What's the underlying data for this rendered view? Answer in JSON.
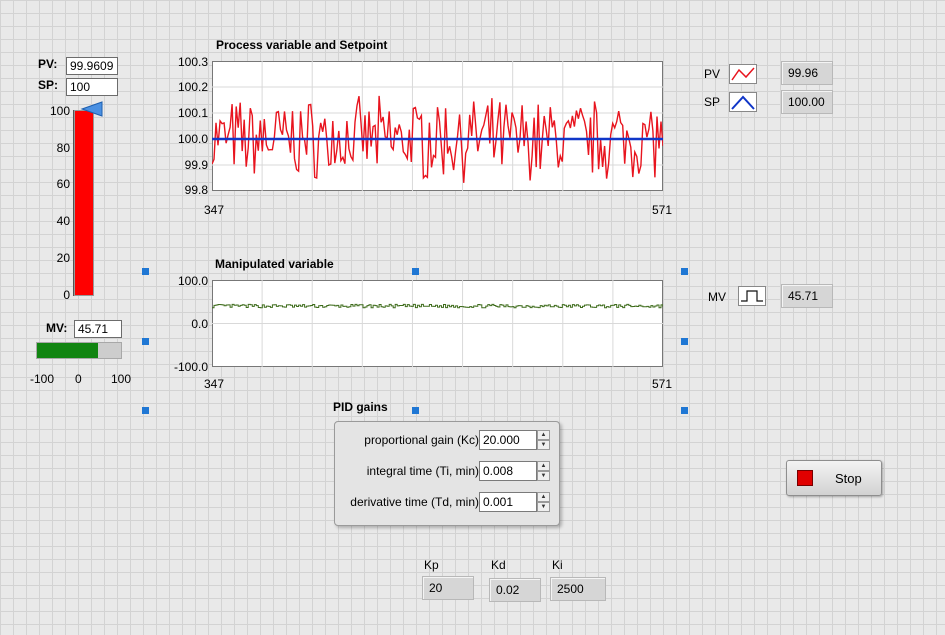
{
  "pv_label": "PV:",
  "pv_value": "99.9609",
  "sp_label": "SP:",
  "sp_value": "100",
  "tank": {
    "ticks": [
      "100",
      "80",
      "60",
      "40",
      "20",
      "0"
    ],
    "level": 100,
    "max": 100,
    "fill_color": "#ff0000"
  },
  "mv_label": "MV:",
  "mv_value": "45.71",
  "mv_bar": {
    "ticks": [
      "-100",
      "0",
      "100"
    ],
    "min": -100,
    "max": 100,
    "value": 45.71,
    "fill_color": "#118511"
  },
  "chart1": {
    "title": "Process variable and Setpoint",
    "yticks": [
      "100.3",
      "100.2",
      "100.1",
      "100.0",
      "99.9",
      "99.8"
    ],
    "xmin_label": "347",
    "xmax_label": "571"
  },
  "chart2": {
    "title": "Manipulated variable",
    "yticks": [
      "100.0",
      "0.0",
      "-100.0"
    ],
    "xmin_label": "347",
    "xmax_label": "571"
  },
  "legend": {
    "pv_name": "PV",
    "pv_value": "99.96",
    "sp_name": "SP",
    "sp_value": "100.00",
    "mv_name": "MV",
    "mv_value": "45.71"
  },
  "pid": {
    "title": "PID gains",
    "rows": [
      {
        "label": "proportional gain (Kc)",
        "value": "20.000"
      },
      {
        "label": "integral time (Ti, min)",
        "value": "0.008"
      },
      {
        "label": "derivative time (Td, min)",
        "value": "0.001"
      }
    ]
  },
  "stop_label": "Stop",
  "gains": {
    "kp_label": "Kp",
    "kp_value": "20",
    "kd_label": "Kd",
    "kd_value": "0.02",
    "ki_label": "Ki",
    "ki_value": "2500"
  },
  "colors": {
    "pv_line": "#e8141e",
    "sp_line": "#1036c8",
    "mv_line": "#3d6b1a"
  },
  "chart_data": [
    {
      "type": "line",
      "title": "Process variable and Setpoint",
      "x": [
        347,
        571
      ],
      "xlim": [
        347,
        571
      ],
      "ylim": [
        99.8,
        100.3
      ],
      "series": [
        {
          "name": "PV",
          "approx_mean": 100.0,
          "approx_range": [
            99.8,
            100.22
          ]
        },
        {
          "name": "SP",
          "values": [
            100.0,
            100.0
          ]
        }
      ]
    },
    {
      "type": "line",
      "title": "Manipulated variable",
      "x": [
        347,
        571
      ],
      "xlim": [
        347,
        571
      ],
      "ylim": [
        -100,
        100
      ],
      "series": [
        {
          "name": "MV",
          "approx_mean": 40,
          "approx_range": [
            35,
            46
          ]
        }
      ]
    }
  ]
}
